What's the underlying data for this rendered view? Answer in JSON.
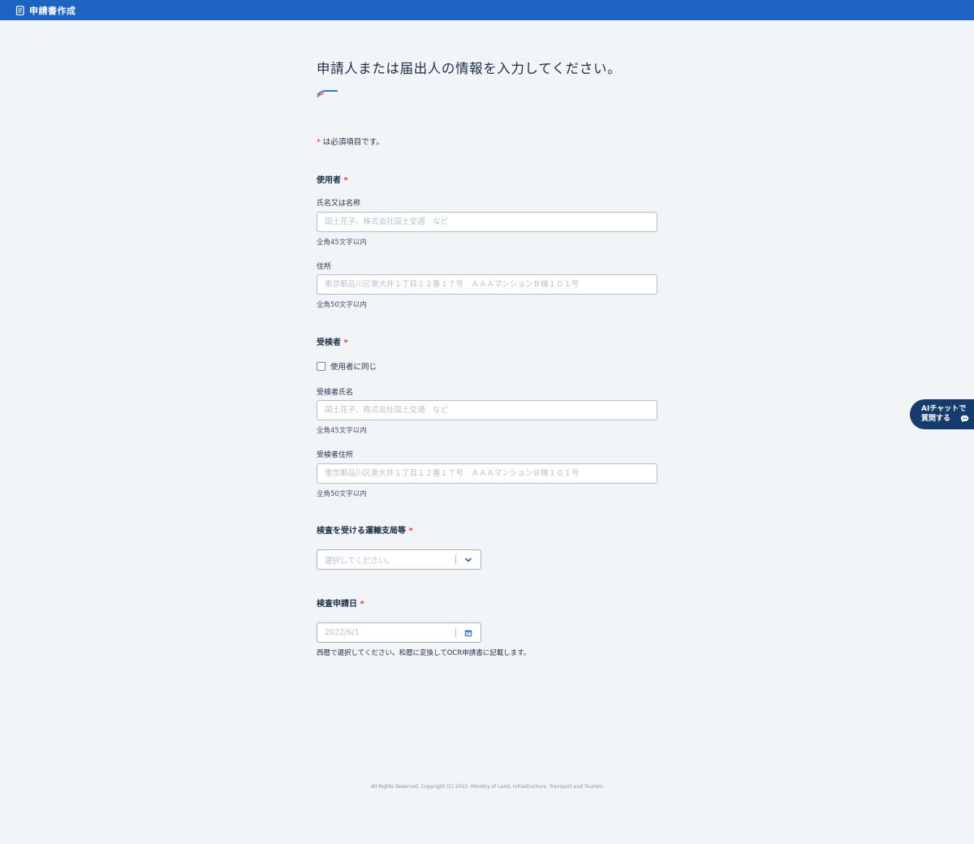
{
  "header": {
    "title": "申請書作成",
    "icon": "document-icon",
    "background_color": "#1d63c1"
  },
  "page_title": "申請人または届出人の情報を入力してください。",
  "required_note": {
    "marker": "*",
    "text": "は必須項目です。"
  },
  "sections": {
    "user": {
      "heading": "使用者",
      "required_marker": "*",
      "name_field": {
        "label": "氏名又は名称",
        "placeholder": "国土花子、株式会社国土交通　など",
        "value": "",
        "hint": "全角45文字以内"
      },
      "address_field": {
        "label": "住所",
        "placeholder": "東京都品川区東大井１丁目１２番１７号　ＡＡＡマンションＢ棟１０１号",
        "value": "",
        "hint": "全角50文字以内"
      }
    },
    "examinee": {
      "heading": "受検者",
      "required_marker": "*",
      "same_as_user_checkbox": {
        "label": "使用者に同じ",
        "checked": false
      },
      "name_field": {
        "label": "受検者氏名",
        "placeholder": "国土花子、株式会社国土交通　など",
        "value": "",
        "hint": "全角45文字以内"
      },
      "address_field": {
        "label": "受検者住所",
        "placeholder": "東京都品川区東大井１丁目１２番１７号　ＡＡＡマンションＢ棟１０１号",
        "value": "",
        "hint": "全角50文字以内"
      }
    },
    "transport_office": {
      "heading": "検査を受ける運輸支局等",
      "required_marker": "*",
      "select": {
        "placeholder": "選択してください。",
        "icon": "chevron-down-icon"
      }
    },
    "inspection_date": {
      "heading": "検査申請日",
      "required_marker": "*",
      "date_input": {
        "placeholder": "2022/6/1",
        "icon": "calendar-icon"
      },
      "hint": "西暦で選択してください。和暦に変換してOCR申請書に記載します。"
    }
  },
  "chat_button": {
    "line1": "AIチャットで",
    "line2": "質問する",
    "icon": "chat-bubble-icon",
    "background_color": "#163c6e"
  },
  "footer": {
    "copyright": "All Rights Reserved, Copyright (C) 2022, Ministry of Land, Infrastructure, Transport and Tourism"
  },
  "colors": {
    "accent": "#1d63c1",
    "required": "#e53935",
    "page_background": "#f1f5f8"
  }
}
